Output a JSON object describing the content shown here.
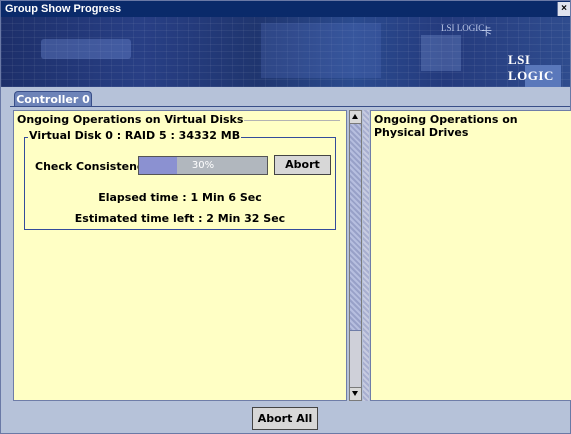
{
  "window": {
    "title": "Group Show Progress",
    "close_glyph": "×"
  },
  "banner": {
    "logo": "LSI LOGIC",
    "small_logo_a": "LSI LOGIC",
    "small_logo_b": "卡"
  },
  "tabs": [
    {
      "label": "Controller 0",
      "selected": true
    }
  ],
  "virtual_panel": {
    "title": "Ongoing Operations on Virtual Disks",
    "disk": {
      "title": "Virtual Disk 0 : RAID 5 : 34332 MB",
      "operation_label": "Check Consistency",
      "progress_percent": 30,
      "progress_text": "30%",
      "abort_label": "Abort",
      "elapsed": "Elapsed time : 1 Min 6 Sec",
      "estimated": "Estimated time left : 2 Min 32 Sec"
    }
  },
  "physical_panel": {
    "title": "Ongoing Operations on Physical Drives"
  },
  "footer": {
    "abort_all_label": "Abort All"
  },
  "colors": {
    "titlebar": "#0a2a6a",
    "panel_bg": "#ffffc5",
    "window_bg": "#b6c2d9",
    "tab": "#6d83b8",
    "progress_fill": "#8b91d1"
  },
  "icons": {
    "close": "close-icon",
    "scroll_up": "arrow-up-icon",
    "scroll_down": "arrow-down-icon"
  }
}
